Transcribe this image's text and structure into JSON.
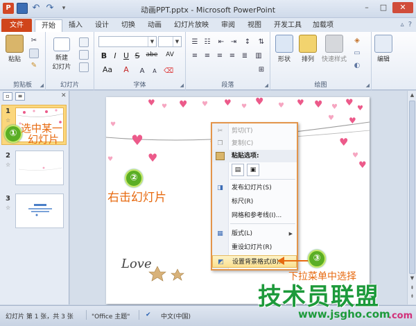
{
  "window": {
    "title": "动画PPT.pptx - Microsoft PowerPoint",
    "app_icon_letter": "P"
  },
  "ribbon_tabs": {
    "file": "文件",
    "tabs": [
      "开始",
      "插入",
      "设计",
      "切换",
      "动画",
      "幻灯片放映",
      "审阅",
      "视图",
      "开发工具",
      "加载项"
    ],
    "active": "开始"
  },
  "ribbon": {
    "clipboard": {
      "paste": "粘贴",
      "label": "剪贴板"
    },
    "slides": {
      "new_slide_line1": "新建",
      "new_slide_line2": "幻灯片",
      "label": "幻灯片"
    },
    "font": {
      "label": "字体",
      "bold": "B",
      "italic": "I",
      "underline": "U",
      "strike": "S",
      "abc": "abe",
      "av": "AV",
      "aa": "Aa",
      "a": "A"
    },
    "paragraph": {
      "label": "段落"
    },
    "drawing": {
      "shapes": "形状",
      "arrange": "排列",
      "quick_styles": "快速样式",
      "label": "绘图"
    },
    "editing": {
      "edit": "编辑"
    }
  },
  "slide_pane": {
    "thumbnails": [
      {
        "number": "1",
        "selected": true
      },
      {
        "number": "2",
        "selected": false
      },
      {
        "number": "3",
        "selected": false
      }
    ],
    "star": "☆"
  },
  "context_menu": {
    "cut": "剪切(T)",
    "copy": "复制(C)",
    "paste_options": "粘贴选项:",
    "publish_slides": "发布幻灯片(S)",
    "ruler": "标尺(R)",
    "grid_guides": "网格和参考线(I)...",
    "layout": "版式(L)",
    "reset_slide": "重设幻灯片(R)",
    "format_background": "设置背景格式(B)..."
  },
  "annotations": {
    "step1_number": "①",
    "step1_line1": "选中某一",
    "step1_line2": "幻灯片",
    "step2_number": "②",
    "step2_text": "右击幻灯片",
    "step3_number": "③",
    "step3_text": "下拉菜单中选择"
  },
  "slide_content": {
    "love_text": "Love"
  },
  "status": {
    "slide_info": "幻灯片 第 1 张，共 3 张",
    "theme": "\"Office 主题\"",
    "language": "中文(中国)"
  },
  "watermark": {
    "main": "技术员联盟",
    "url": "www.jsgho.com",
    "com": ".com"
  },
  "colors": {
    "file_tab": "#d0451b",
    "annotation": "#e76a10",
    "badge": "#5aae24",
    "watermark_green": "#1d9a3b",
    "menu_border": "#e3944a"
  }
}
